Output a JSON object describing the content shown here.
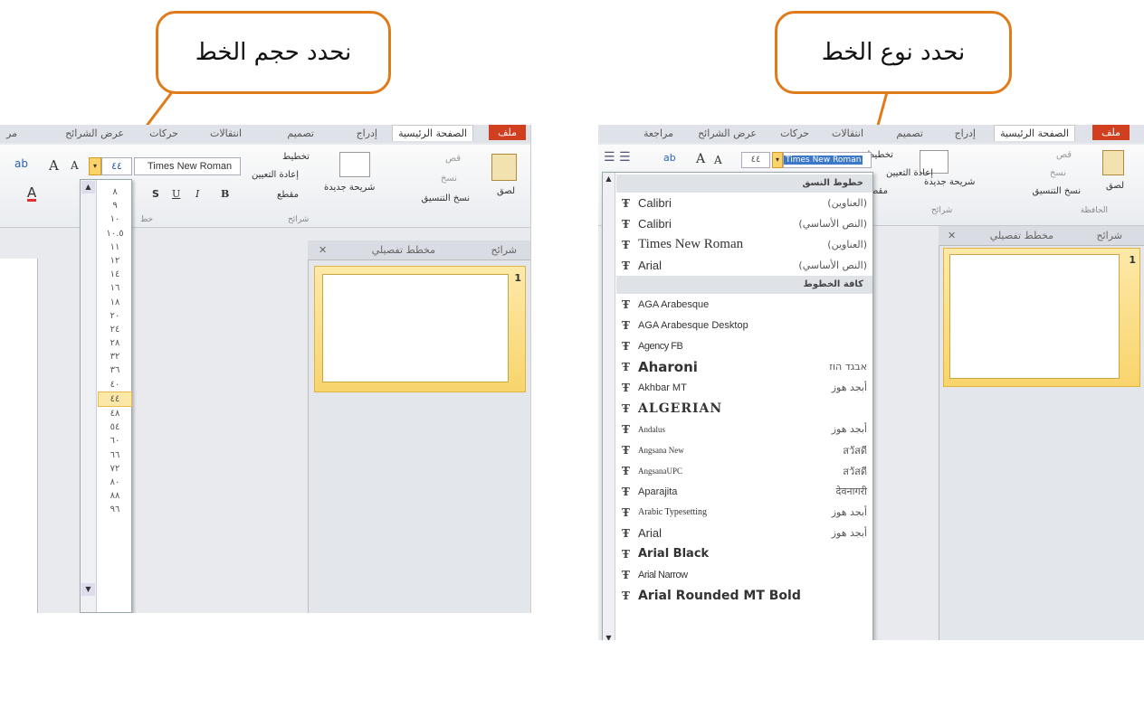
{
  "callouts": {
    "left": "نحدد حجم الخط",
    "right": "نحدد نوع الخط"
  },
  "colors": {
    "callout_border": "#e07b1c",
    "accent_file": "#d04020",
    "selection": "#fbe7a7"
  },
  "left_panel": {
    "tabs": [
      "ملف",
      "الصفحة الرئيسية",
      "إدراج",
      "تصميم",
      "انتقالات",
      "حركات",
      "عرض الشرائح",
      "مر"
    ],
    "ribbon": {
      "font_name": "Times New Roman",
      "font_size": "٤٤",
      "new_slide": "شريحة جديدة",
      "layout": "تخطيط",
      "reset": "إعادة التعيين",
      "section": "مقطع",
      "paste": "لصق",
      "cut": "قص",
      "copy": "نسخ",
      "format_painter": "نسخ التنسيق",
      "group_slides": "شرائح",
      "group_font": "خط",
      "bold": "B",
      "italic": "I",
      "underline": "U",
      "strike": "S"
    },
    "size_list": [
      "٨",
      "٩",
      "١٠",
      "١٠.٥",
      "١١",
      "١٢",
      "١٤",
      "١٦",
      "١٨",
      "٢٠",
      "٢٤",
      "٢٨",
      "٣٢",
      "٣٦",
      "٤٠",
      "٤٤",
      "٤٨",
      "٥٤",
      "٦٠",
      "٦٦",
      "٧٢",
      "٨٠",
      "٨٨",
      "٩٦"
    ],
    "selected_size": "٤٤",
    "pane_tabs": {
      "slides": "شرائح",
      "outline": "مخطط تفصيلي",
      "close": "✕"
    },
    "slide_number": "1"
  },
  "right_panel": {
    "tabs": [
      "ملف",
      "الصفحة الرئيسية",
      "إدراج",
      "تصميم",
      "انتقالات",
      "حركات",
      "عرض الشرائح",
      "مراجعة"
    ],
    "ribbon": {
      "font_name": "Times New Roman",
      "font_size": "٤٤",
      "new_slide": "شريحة جديدة",
      "layout": "تخطيط",
      "reset": "إعادة التعيين",
      "section": "مقطع",
      "paste": "لصق",
      "cut": "قص",
      "copy": "نسخ",
      "format_painter": "نسخ التنسيق",
      "group_clipboard": "الحافظة",
      "group_slides": "شرائح"
    },
    "theme_fonts_header": "خطوط النسق",
    "theme_fonts": [
      {
        "name": "Calibri",
        "role": "(العناوين)"
      },
      {
        "name": "Calibri",
        "role": "(النص الأساسي)"
      },
      {
        "name": "Times New Roman",
        "role": "(العناوين)"
      },
      {
        "name": "Arial",
        "role": "(النص الأساسي)"
      }
    ],
    "all_fonts_header": "كافة الخطوط",
    "all_fonts": [
      {
        "name": "AGA Arabesque",
        "sample": ""
      },
      {
        "name": "AGA Arabesque Desktop",
        "sample": ""
      },
      {
        "name": "Agency FB",
        "sample": ""
      },
      {
        "name": "Aharoni",
        "sample": "אבגד הוז"
      },
      {
        "name": "Akhbar MT",
        "sample": "أبجد هوز"
      },
      {
        "name": "ALGERIAN",
        "sample": ""
      },
      {
        "name": "Andalus",
        "sample": "أبجد هوز"
      },
      {
        "name": "Angsana New",
        "sample": "สวัสดี"
      },
      {
        "name": "AngsanaUPC",
        "sample": "สวัสดี"
      },
      {
        "name": "Aparajita",
        "sample": "देवनागरी"
      },
      {
        "name": "Arabic Typesetting",
        "sample": "أبجد هوز"
      },
      {
        "name": "Arial",
        "sample": "أبجد هوز"
      },
      {
        "name": "Arial Black",
        "sample": ""
      },
      {
        "name": "Arial Narrow",
        "sample": ""
      },
      {
        "name": "Arial Rounded MT Bold",
        "sample": ""
      }
    ],
    "pane_tabs": {
      "slides": "شرائح",
      "outline": "مخطط تفصيلي",
      "close": "✕"
    },
    "slide_number": "1"
  }
}
